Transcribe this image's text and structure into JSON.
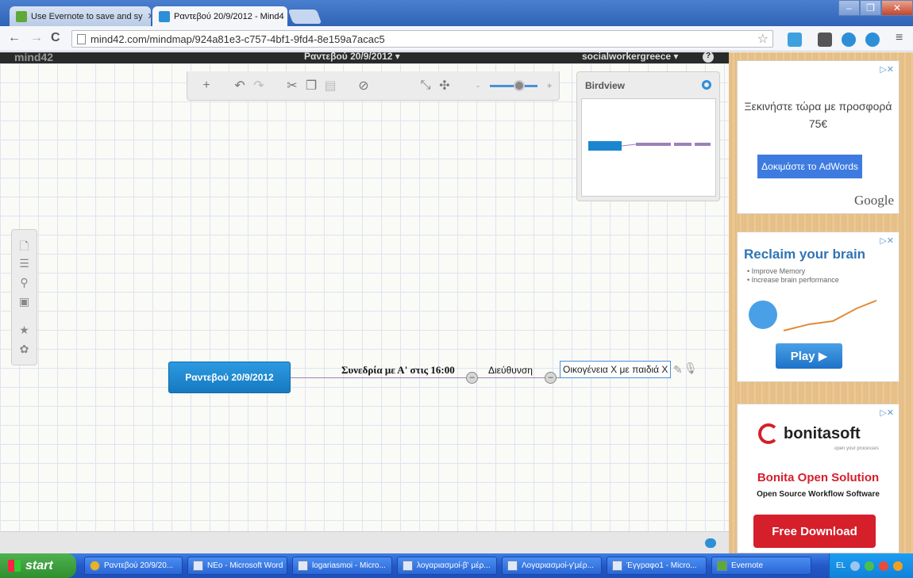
{
  "browser": {
    "tabs": [
      {
        "label": "Use Evernote to save and sy",
        "active": false
      },
      {
        "label": "Ραντεβού 20/9/2012 - Mind4",
        "active": true
      }
    ],
    "address": "mind42.com/mindmap/924a81e3-c757-4bf1-9fd4-8e159a7acac5"
  },
  "app": {
    "logo": "mind42",
    "document_title": "Ραντεβού 20/9/2012 ▾",
    "user_menu": "socialworkergreece ▾",
    "help": "?",
    "birdview_title": "Birdview"
  },
  "mindmap": {
    "root": "Ραντεβού 20/9/2012",
    "node1": "Συνεδρία με Α' στις 16:00",
    "node2": "Διεύθυνση",
    "node3_editing": "Οικογένεια Χ με παιδιά Χ"
  },
  "ads": {
    "adwords": {
      "headline": "Ξεκινήστε τώρα με προσφορά 75€",
      "button": "Δοκιμάστε το AdWords",
      "brand": "Google"
    },
    "brain": {
      "title": "Reclaim your brain",
      "bullet1": "• Improve Memory",
      "bullet2": "• Increase brain performance",
      "button": "Play ▶"
    },
    "bonita": {
      "logo": "bonitasoft",
      "tagline": "open your processes",
      "title": "Bonita Open Solution",
      "subtitle": "Open Source Workflow Software",
      "button": "Free Download"
    }
  },
  "taskbar": {
    "start": "start",
    "tasks": [
      "Ραντεβού 20/9/20...",
      "NEo - Microsoft Word",
      "logariasmoi - Micro...",
      "λογαριασμοί-β' μέρ...",
      "Λογαριασμοί-γ'μέρ...",
      "Έγγραφο1 - Micro...",
      "Evernote"
    ],
    "language": "EL"
  },
  "colors": {
    "accent": "#2d8fd8",
    "root_node": "#1b86cf",
    "edge": "#9b82b8"
  }
}
